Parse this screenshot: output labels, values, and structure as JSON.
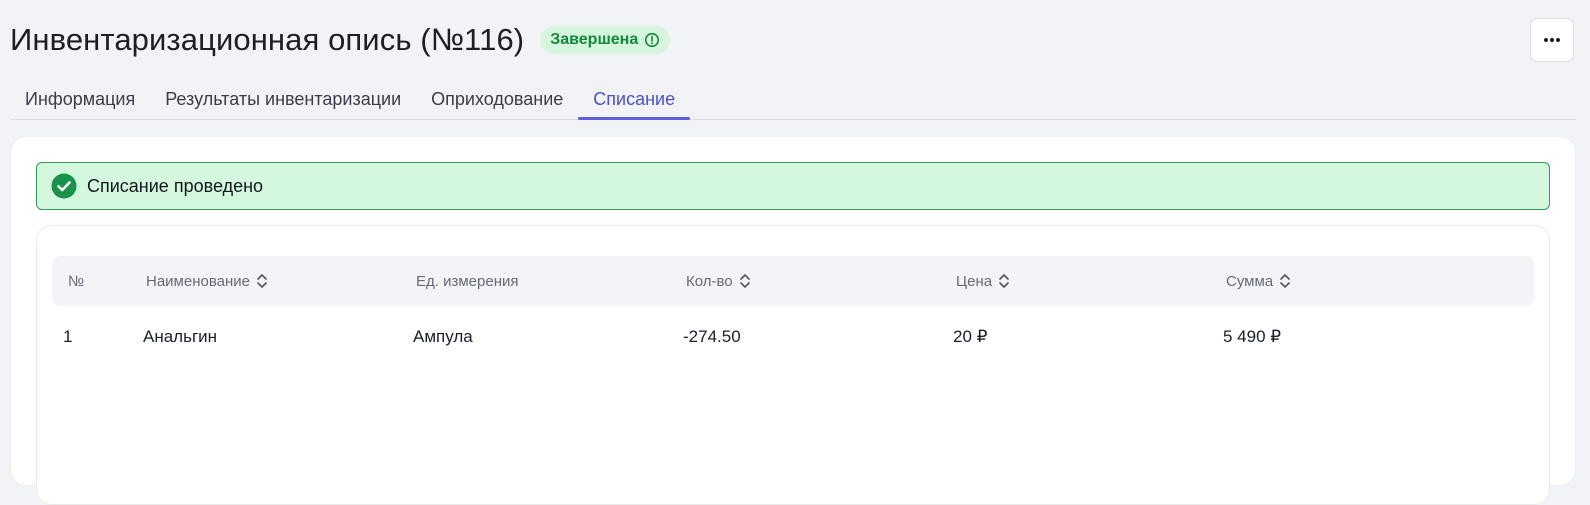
{
  "header": {
    "title": "Инвентаризационная опись (№116)",
    "status": "Завершена"
  },
  "tabs": [
    {
      "label": "Информация",
      "active": false
    },
    {
      "label": "Результаты инвентаризации",
      "active": false
    },
    {
      "label": "Оприходование",
      "active": false
    },
    {
      "label": "Списание",
      "active": true
    }
  ],
  "alert": {
    "text": "Списание проведено"
  },
  "table": {
    "columns": [
      {
        "label": "№",
        "sortable": false
      },
      {
        "label": "Наименование",
        "sortable": true
      },
      {
        "label": "Ед. измерения",
        "sortable": false
      },
      {
        "label": "Кол-во",
        "sortable": true
      },
      {
        "label": "Цена",
        "sortable": true
      },
      {
        "label": "Сумма",
        "sortable": true
      }
    ],
    "rows": [
      [
        "1",
        "Анальгин",
        "Ампула",
        "-274.50",
        "20 ₽",
        "5 490 ₽"
      ]
    ]
  },
  "colors": {
    "accent": "#4a4fd8",
    "success": "#12893a",
    "success_bg": "#d3f8de",
    "page_bg": "#f2f3f7"
  },
  "icons": {
    "status": "info-circle-icon",
    "more": "more-horizontal-icon",
    "alert": "check-circle-icon",
    "sort": "sort-updown-icon"
  }
}
